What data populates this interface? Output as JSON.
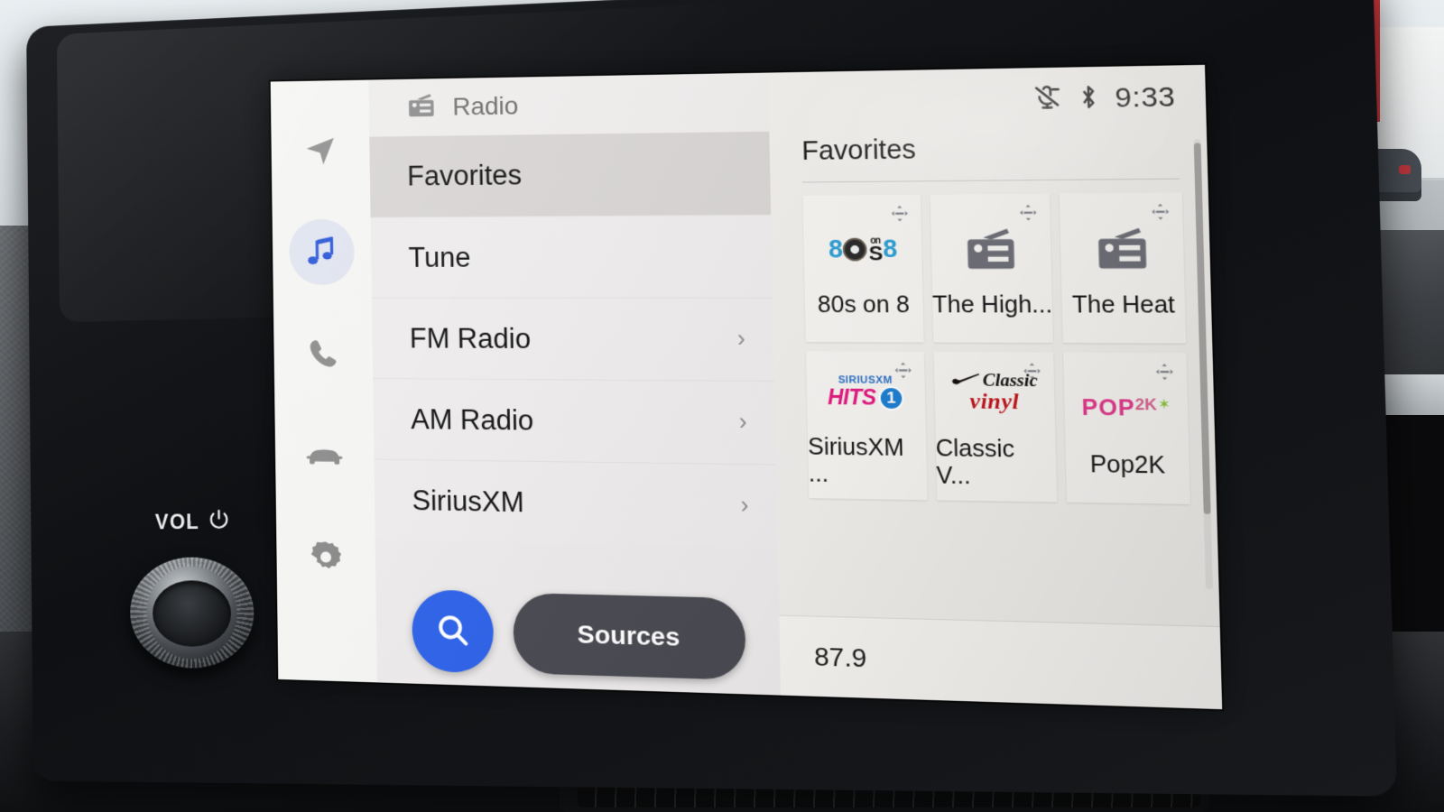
{
  "hardware": {
    "vol_label": "VOL",
    "power_icon": "power-icon",
    "volume_knob": "volume-knob"
  },
  "sidebar": {
    "items": [
      {
        "icon": "navigation-arrow-icon",
        "name": "navigation",
        "active": false
      },
      {
        "icon": "music-note-icon",
        "name": "media",
        "active": true
      },
      {
        "icon": "phone-icon",
        "name": "phone",
        "active": false
      },
      {
        "icon": "car-icon",
        "name": "vehicle",
        "active": false
      },
      {
        "icon": "gear-icon",
        "name": "settings",
        "active": false
      }
    ]
  },
  "list_panel": {
    "header": {
      "icon": "radio-icon",
      "title": "Radio"
    },
    "rows": [
      {
        "label": "Favorites",
        "selected": true,
        "chevron": ""
      },
      {
        "label": "Tune",
        "selected": false,
        "chevron": ""
      },
      {
        "label": "FM Radio",
        "selected": false,
        "chevron": "›"
      },
      {
        "label": "AM Radio",
        "selected": false,
        "chevron": "›"
      },
      {
        "label": "SiriusXM",
        "selected": false,
        "chevron": "›"
      }
    ],
    "search_button": {
      "icon": "search-icon",
      "label": ""
    },
    "sources_button": {
      "label": "Sources"
    }
  },
  "status_bar": {
    "mic_muted_icon": "microphone-muted-icon",
    "bluetooth_icon": "bluetooth-icon",
    "time": "9:33"
  },
  "favorites_panel": {
    "title": "Favorites",
    "tiles": [
      {
        "label": "80s on 8",
        "art": "logo-80s-on-8",
        "drag_handle": "drag-handle-icon"
      },
      {
        "label": "The High...",
        "art": "generic-radio",
        "drag_handle": "drag-handle-icon"
      },
      {
        "label": "The Heat",
        "art": "generic-radio",
        "drag_handle": "drag-handle-icon"
      },
      {
        "label": "SiriusXM ...",
        "art": "logo-sxm-hits1",
        "drag_handle": "drag-handle-icon"
      },
      {
        "label": "Classic V...",
        "art": "logo-classic-vinyl",
        "drag_handle": "drag-handle-icon"
      },
      {
        "label": "Pop2K",
        "art": "logo-pop2k",
        "drag_handle": "drag-handle-icon"
      }
    ],
    "logo_text": {
      "eighties": {
        "left": "8",
        "mid_on": "on",
        "mid_s": "S",
        "right": "8"
      },
      "hits1": {
        "top": "SIRIUSXM",
        "word": "HITS",
        "badge": "1"
      },
      "vinyl": {
        "top": "Classic",
        "bottom": "vinyl"
      },
      "pop2k": {
        "pop": "POP",
        "twok": "2K",
        "star": "✶"
      }
    }
  },
  "now_playing": {
    "frequency": "87.9"
  },
  "colors": {
    "accent_blue": "#2f63e8",
    "sources_dark": "#4a4a52",
    "active_pill": "#dfe3ee",
    "selected_row": "#d7d4d3",
    "screen_bg": "#efedea"
  }
}
